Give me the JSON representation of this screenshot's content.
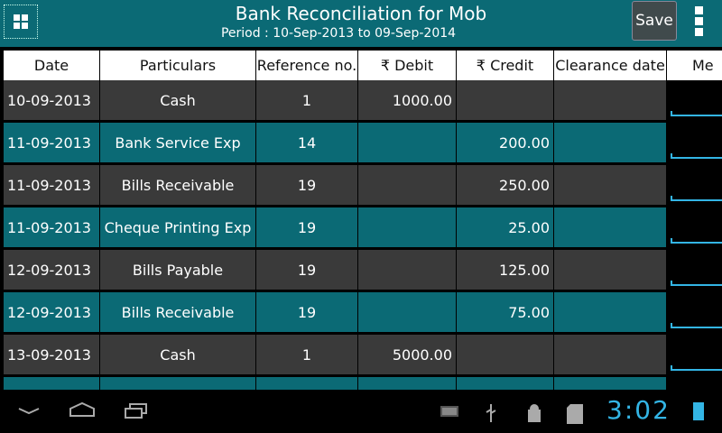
{
  "header": {
    "title": "Bank Reconciliation for Mob",
    "subtitle": "Period : 10-Sep-2013 to 09-Sep-2014",
    "save_label": "Save"
  },
  "table": {
    "columns": [
      "Date",
      "Particulars",
      "Reference no.",
      "₹ Debit",
      "₹ Credit",
      "Clearance date",
      "Me"
    ],
    "rows": [
      {
        "date": "10-09-2013",
        "particulars": "Cash",
        "ref": "1",
        "debit": "1000.00",
        "credit": "",
        "clearance": ""
      },
      {
        "date": "11-09-2013",
        "particulars": "Bank Service Exp",
        "ref": "14",
        "debit": "",
        "credit": "200.00",
        "clearance": ""
      },
      {
        "date": "11-09-2013",
        "particulars": "Bills Receivable",
        "ref": "19",
        "debit": "",
        "credit": "250.00",
        "clearance": ""
      },
      {
        "date": "11-09-2013",
        "particulars": "Cheque Printing Exp",
        "ref": "19",
        "debit": "",
        "credit": "25.00",
        "clearance": ""
      },
      {
        "date": "12-09-2013",
        "particulars": "Bills Payable",
        "ref": "19",
        "debit": "",
        "credit": "125.00",
        "clearance": ""
      },
      {
        "date": "12-09-2013",
        "particulars": "Bills Receivable",
        "ref": "19",
        "debit": "",
        "credit": "75.00",
        "clearance": ""
      },
      {
        "date": "13-09-2013",
        "particulars": "Cash",
        "ref": "1",
        "debit": "5000.00",
        "credit": "",
        "clearance": ""
      },
      {
        "date": "",
        "particulars": "",
        "ref": "",
        "debit": "",
        "credit": "",
        "clearance": ""
      }
    ]
  },
  "status_bar": {
    "time": "3:02"
  },
  "colors": {
    "accent": "#0b6a75",
    "row_dark": "#3a3a3a",
    "clock": "#33b5e5"
  }
}
